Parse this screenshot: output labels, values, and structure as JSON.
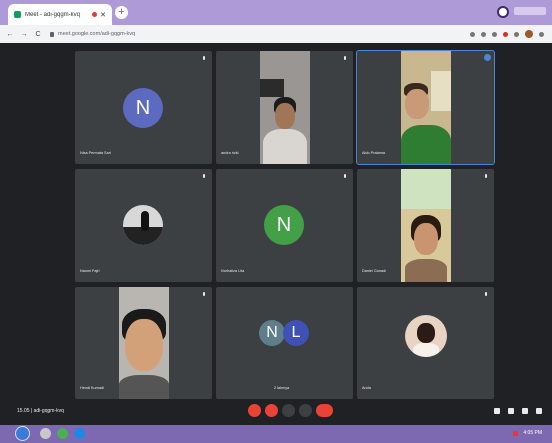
{
  "browser": {
    "tab_title": "Meet - adi-gqgm-kvq",
    "tab_close": "✕",
    "new_tab": "+",
    "url": "meet.google.com/adi-gqgm-kvq",
    "nav_back": "←",
    "nav_forward": "→",
    "nav_reload": "C"
  },
  "participants": [
    {
      "name": "Nisa Permata Sari",
      "initial": "N",
      "color": "#5c6bc0"
    },
    {
      "name": "andra rizki",
      "type": "video"
    },
    {
      "name": "Aldo Pratama",
      "type": "video"
    },
    {
      "name": "Naomi Fajri",
      "type": "image"
    },
    {
      "name": "Nurhaliza Lita",
      "initial": "N",
      "color": "#43a047"
    },
    {
      "name": "Daniel Gunadi",
      "type": "video"
    },
    {
      "name": "Hendi Kurnadi",
      "type": "video"
    },
    {
      "name": "2 lainnya",
      "initials": [
        "N",
        "L"
      ],
      "colors": [
        "#607d8b",
        "#3f51b5"
      ]
    },
    {
      "name": "Anda",
      "type": "image"
    }
  ],
  "bottom": {
    "meeting_info": "15.05 | adi-gqgm-kvq"
  },
  "taskbar": {
    "time": "4:05 PM"
  }
}
